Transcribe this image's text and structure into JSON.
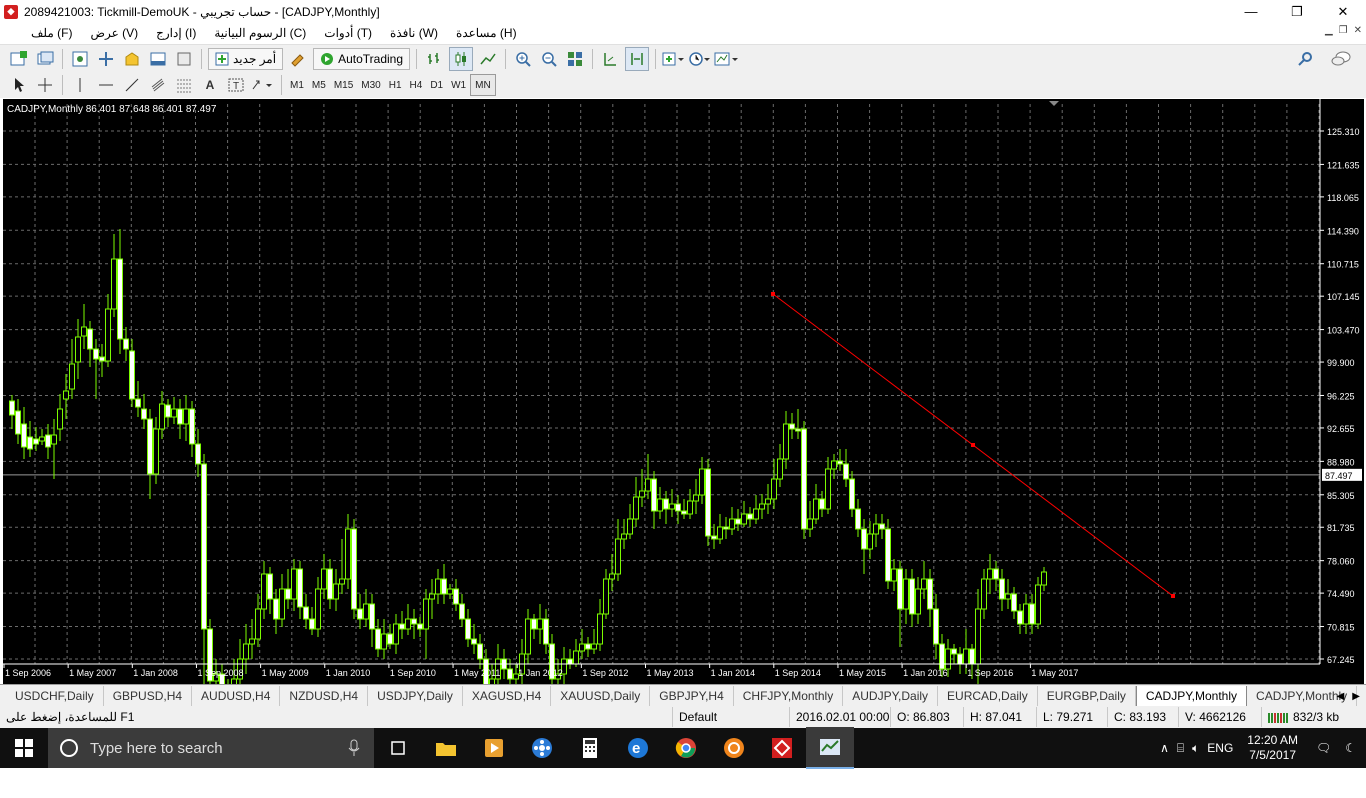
{
  "titlebar": {
    "title": "2089421003: Tickmill-DemoUK - حساب تجريبي - [CADJPY,Monthly]",
    "minimize": "—",
    "restore": "❐",
    "close": "✕"
  },
  "menu": [
    "ملف (F)",
    "عرض (V)",
    "إدارج (I)",
    "الرسوم البيانية (C)",
    "أدوات (T)",
    "نافذة (W)",
    "مساعدة (H)"
  ],
  "toolbar": {
    "new_order": "أمر جديد",
    "autotrading": "AutoTrading"
  },
  "timeframes": [
    "M1",
    "M5",
    "M15",
    "M30",
    "H1",
    "H4",
    "D1",
    "W1",
    "MN"
  ],
  "active_timeframe": "MN",
  "chart": {
    "header": "CADJPY,Monthly  86.401 87.648 86.401 87.497",
    "price_labels": [
      "125.310",
      "121.635",
      "118.065",
      "114.390",
      "110.715",
      "107.145",
      "103.470",
      "99.900",
      "96.225",
      "92.655",
      "88.980",
      "85.305",
      "81.735",
      "78.060",
      "74.490",
      "70.815",
      "67.245"
    ],
    "current_price": "87.497",
    "date_labels": [
      "1 Sep 2006",
      "1 May 2007",
      "1 Jan 2008",
      "1 Sep 2008",
      "1 May 2009",
      "1 Jan 2010",
      "1 Sep 2010",
      "1 May 2011",
      "1 Jan 2012",
      "1 Sep 2012",
      "1 May 2013",
      "1 Jan 2014",
      "1 Sep 2014",
      "1 May 2015",
      "1 Jan 2016",
      "1 Sep 2016",
      "1 May 2017"
    ],
    "colors": {
      "background": "#000000",
      "grid": "#6b6b6b",
      "candle": "#7cfc00",
      "trendline": "#ff0000",
      "axis": "#ffffff"
    }
  },
  "tabs": [
    "USDCHF,Daily",
    "GBPUSD,H4",
    "AUDUSD,H4",
    "NZDUSD,H4",
    "USDJPY,Daily",
    "XAGUSD,H4",
    "XAUUSD,Daily",
    "GBPJPY,H4",
    "CHFJPY,Monthly",
    "AUDJPY,Daily",
    "EURCAD,Daily",
    "EURGBP,Daily",
    "CADJPY,Monthly",
    "CADJPY,Monthly"
  ],
  "active_tab_index": 12,
  "status": {
    "help": "للمساعدة، إضغط على  F1",
    "profile": "Default",
    "datetime": "2016.02.01 00:00",
    "open": "O: 86.803",
    "high": "H: 87.041",
    "low": "L: 79.271",
    "close": "C: 83.193",
    "volume": "V: 4662126",
    "traffic": "832/3 kb"
  },
  "taskbar": {
    "search_placeholder": "Type here to search",
    "lang": "ENG",
    "time": "12:20 AM",
    "date": "7/5/2017"
  }
}
